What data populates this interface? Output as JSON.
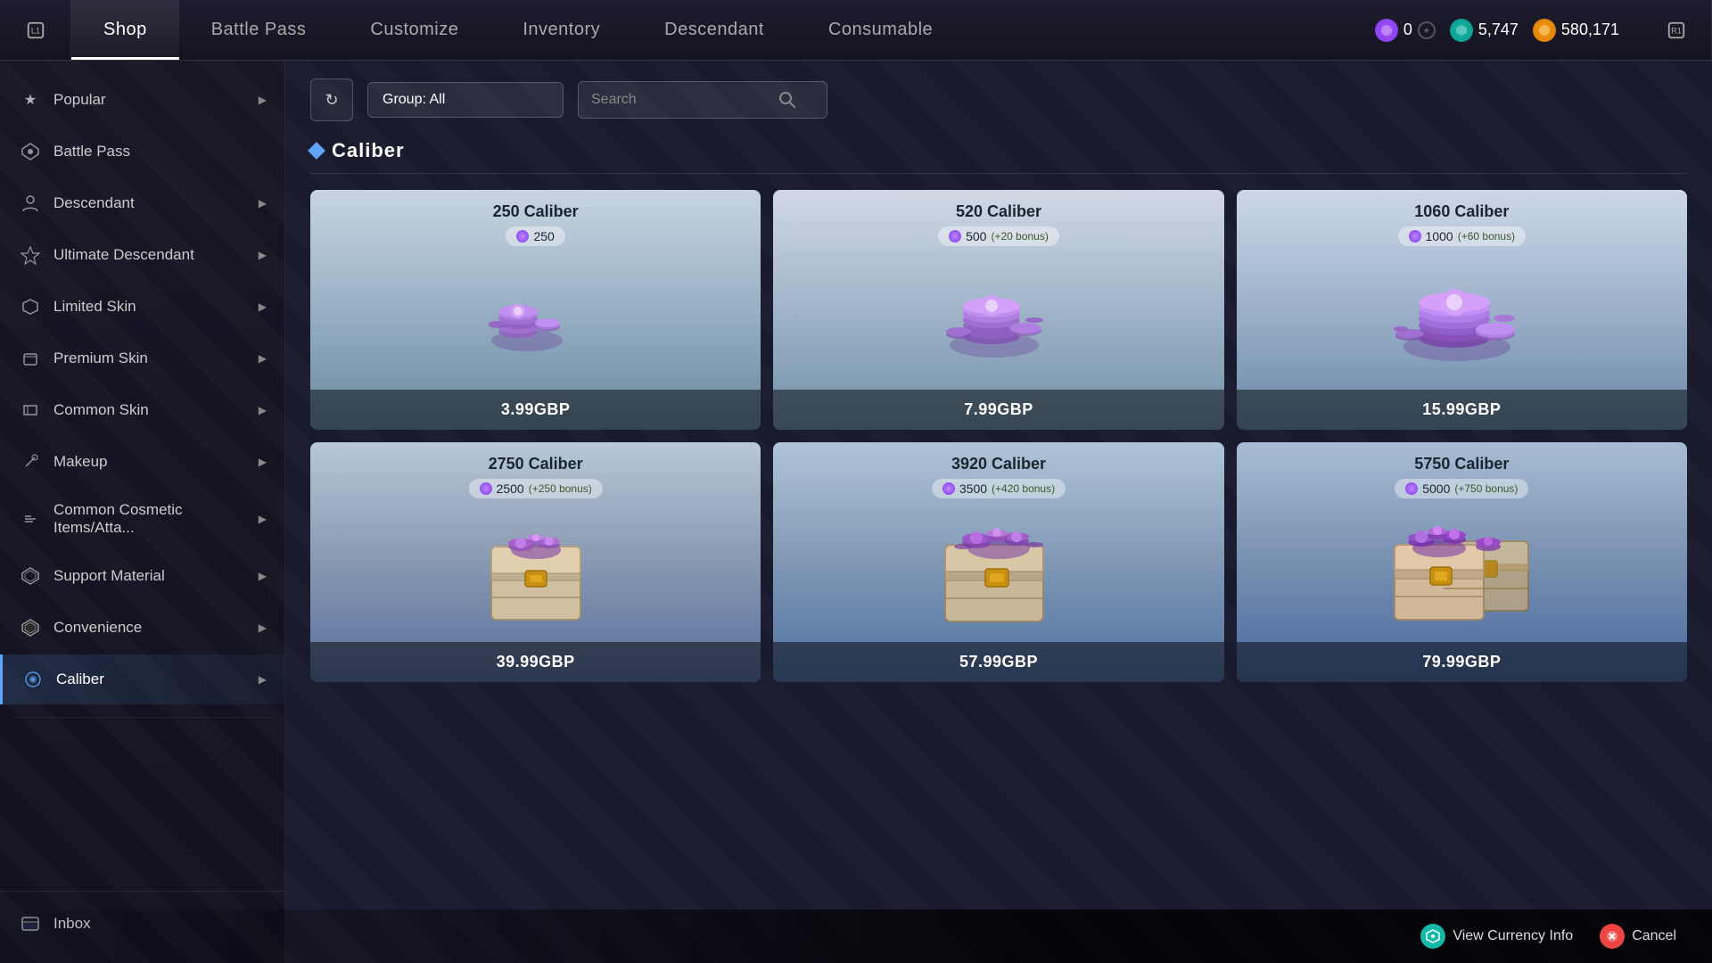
{
  "nav": {
    "left_icon": "L1",
    "right_icon": "R1",
    "tabs": [
      {
        "label": "Shop",
        "active": true
      },
      {
        "label": "Battle Pass",
        "active": false
      },
      {
        "label": "Customize",
        "active": false
      },
      {
        "label": "Inventory",
        "active": false
      },
      {
        "label": "Descendant",
        "active": false
      },
      {
        "label": "Consumable",
        "active": false
      }
    ],
    "currencies": [
      {
        "icon_type": "purple",
        "value": "0",
        "has_plus": true
      },
      {
        "icon_type": "teal",
        "value": "5,747",
        "has_plus": false
      },
      {
        "icon_type": "gold",
        "value": "580,171",
        "has_plus": false
      }
    ]
  },
  "sidebar": {
    "items": [
      {
        "label": "Popular",
        "has_chevron": true,
        "active": false,
        "icon": "★"
      },
      {
        "label": "Battle Pass",
        "has_chevron": false,
        "active": false,
        "icon": "◈"
      },
      {
        "label": "Descendant",
        "has_chevron": true,
        "active": false,
        "icon": "👤"
      },
      {
        "label": "Ultimate Descendant",
        "has_chevron": true,
        "active": false,
        "icon": "⚡"
      },
      {
        "label": "Limited Skin",
        "has_chevron": true,
        "active": false,
        "icon": "◆"
      },
      {
        "label": "Premium Skin",
        "has_chevron": true,
        "active": false,
        "icon": "◇"
      },
      {
        "label": "Common Skin",
        "has_chevron": true,
        "active": false,
        "icon": "▷"
      },
      {
        "label": "Makeup",
        "has_chevron": true,
        "active": false,
        "icon": "✦"
      },
      {
        "label": "Common Cosmetic Items/Atta...",
        "has_chevron": true,
        "active": false,
        "icon": "🔧"
      },
      {
        "label": "Support Material",
        "has_chevron": true,
        "active": false,
        "icon": "⬡"
      },
      {
        "label": "Convenience",
        "has_chevron": true,
        "active": false,
        "icon": "⬢"
      },
      {
        "label": "Caliber",
        "has_chevron": true,
        "active": true,
        "icon": "◉"
      }
    ],
    "inbox": {
      "label": "Inbox",
      "icon": "📥"
    }
  },
  "filter": {
    "group_label": "Group: All",
    "search_placeholder": "Search",
    "refresh_icon": "↻"
  },
  "section": {
    "title": "Caliber"
  },
  "shop_items": [
    {
      "name": "250 Caliber",
      "amount": "250",
      "bonus": null,
      "price": "3.99GBP",
      "size": "small"
    },
    {
      "name": "520 Caliber",
      "amount": "500",
      "bonus": "(+20 bonus)",
      "price": "7.99GBP",
      "size": "medium"
    },
    {
      "name": "1060 Caliber",
      "amount": "1000",
      "bonus": "(+60 bonus)",
      "price": "15.99GBP",
      "size": "large"
    },
    {
      "name": "2750 Caliber",
      "amount": "2500",
      "bonus": "(+250 bonus)",
      "price": "39.99GBP",
      "size": "chest-small"
    },
    {
      "name": "3920 Caliber",
      "amount": "3500",
      "bonus": "(+420 bonus)",
      "price": "57.99GBP",
      "size": "chest-medium"
    },
    {
      "name": "5750 Caliber",
      "amount": "5000",
      "bonus": "(+750 bonus)",
      "price": "79.99GBP",
      "size": "chest-large"
    }
  ],
  "bottom": {
    "view_currency_info": "View Currency Info",
    "cancel": "Cancel"
  }
}
